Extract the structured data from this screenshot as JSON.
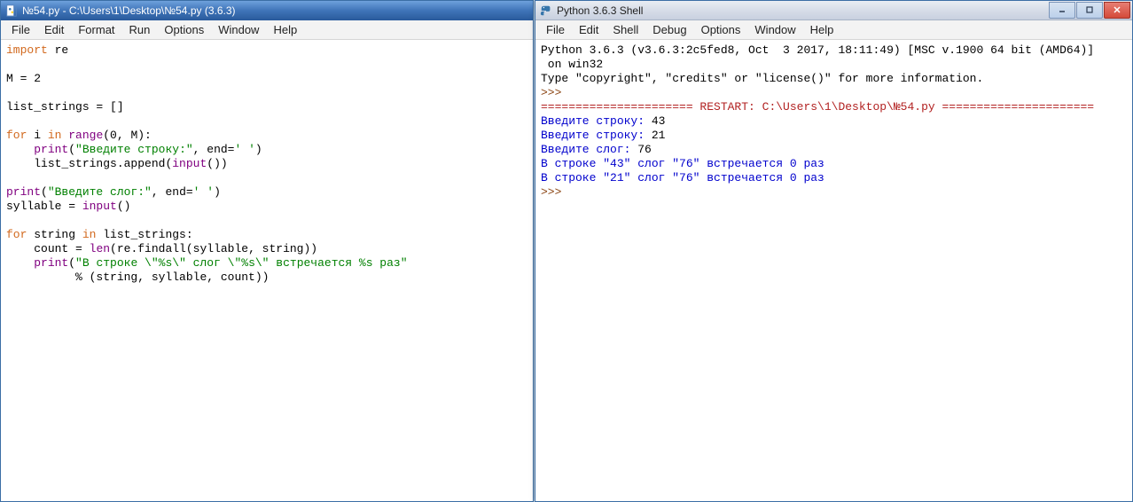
{
  "editor": {
    "title": "№54.py - C:\\Users\\1\\Desktop\\№54.py (3.6.3)",
    "menu": [
      "File",
      "Edit",
      "Format",
      "Run",
      "Options",
      "Window",
      "Help"
    ],
    "code": {
      "l1": {
        "kw": "import",
        "mod": " re"
      },
      "l3": "M = 2",
      "l5": "list_strings = []",
      "l7": {
        "kw1": "for",
        "t1": " i ",
        "kw2": "in",
        "t2": " ",
        "fn": "range",
        "t3": "(0, M):"
      },
      "l8": {
        "indent": "    ",
        "fn": "print",
        "t1": "(",
        "str": "\"Введите строку:\"",
        "t2": ", end=",
        "str2": "' '",
        "t3": ")"
      },
      "l9": {
        "indent": "    ",
        "t1": "list_strings.append(",
        "fn": "input",
        "t2": "())"
      },
      "l11": {
        "fn": "print",
        "t1": "(",
        "str": "\"Введите слог:\"",
        "t2": ", end=",
        "str2": "' '",
        "t3": ")"
      },
      "l12": {
        "t1": "syllable = ",
        "fn": "input",
        "t2": "()"
      },
      "l14": {
        "kw1": "for",
        "t1": " string ",
        "kw2": "in",
        "t2": " list_strings:"
      },
      "l15": {
        "indent": "    ",
        "t1": "count = ",
        "fn": "len",
        "t2": "(re.findall(syllable, string))"
      },
      "l16": {
        "indent": "    ",
        "fn": "print",
        "t1": "(",
        "str": "\"В строке \\\"%s\\\" слог \\\"%s\\\" встречается %s раз\""
      },
      "l17": {
        "indent": "          ",
        "t1": "% (string, syllable, count))"
      }
    }
  },
  "shell": {
    "title": "Python 3.6.3 Shell",
    "menu": [
      "File",
      "Edit",
      "Shell",
      "Debug",
      "Options",
      "Window",
      "Help"
    ],
    "banner1": "Python 3.6.3 (v3.6.3:2c5fed8, Oct  3 2017, 18:11:49) [MSC v.1900 64 bit (AMD64)]",
    "banner2": " on win32",
    "banner3": "Type \"copyright\", \"credits\" or \"license()\" for more information.",
    "prompt": ">>> ",
    "restart": "====================== RESTART: C:\\Users\\1\\Desktop\\№54.py ======================",
    "line1": {
      "p": "Введите строку: ",
      "v": "43"
    },
    "line2": {
      "p": "Введите строку: ",
      "v": "21"
    },
    "line3": {
      "p": "Введите слог: ",
      "v": "76"
    },
    "line4": "В строке \"43\" слог \"76\" встречается 0 раз",
    "line5": "В строке \"21\" слог \"76\" встречается 0 раз"
  }
}
